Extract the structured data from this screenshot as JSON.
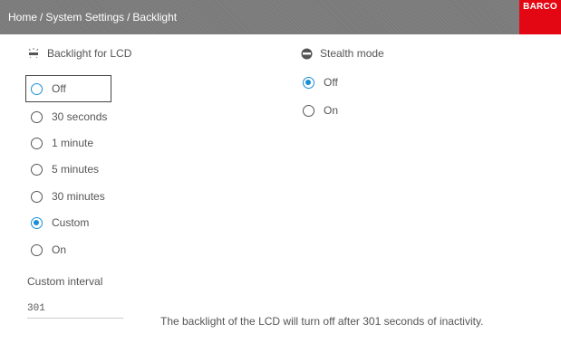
{
  "header": {
    "breadcrumb": [
      "Home",
      "System Settings",
      "Backlight"
    ],
    "separator": "/",
    "logo_text": "BARCO",
    "logo_color": "#e30613",
    "bar_color": "#7a7a7a"
  },
  "backlight": {
    "title": "Backlight for LCD",
    "icon": "backlight-icon",
    "options": [
      {
        "label": "Off",
        "selected": false,
        "focused": true
      },
      {
        "label": "30 seconds",
        "selected": false
      },
      {
        "label": "1 minute",
        "selected": false
      },
      {
        "label": "5 minutes",
        "selected": false
      },
      {
        "label": "30 minutes",
        "selected": false
      },
      {
        "label": "Custom",
        "selected": true
      },
      {
        "label": "On",
        "selected": false
      }
    ]
  },
  "stealth": {
    "title": "Stealth mode",
    "icon": "stealth-mask-icon",
    "options": [
      {
        "label": "Off",
        "selected": true
      },
      {
        "label": "On",
        "selected": false
      }
    ]
  },
  "custom_interval": {
    "label": "Custom interval",
    "value": "301"
  },
  "status_text": "The backlight of the LCD will turn off after 301 seconds of inactivity.",
  "accent_color": "#1a8fd6"
}
